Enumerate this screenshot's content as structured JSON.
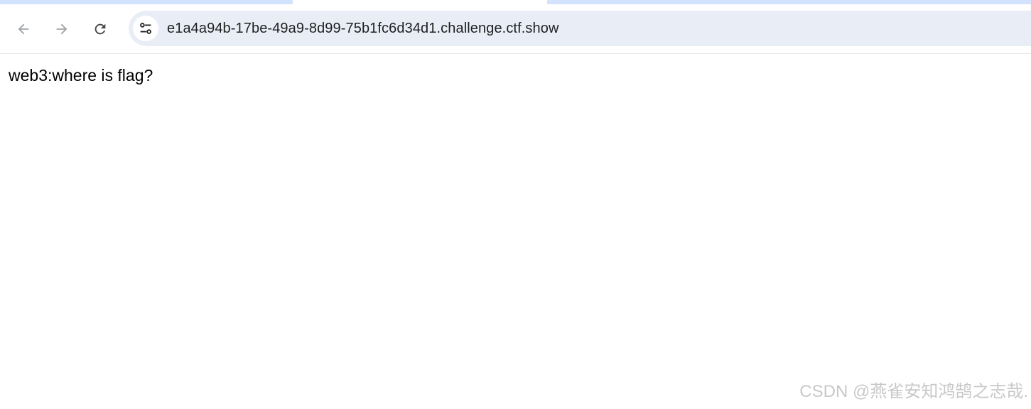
{
  "browser": {
    "nav": {
      "back_icon": "arrow-left-icon",
      "forward_icon": "arrow-right-icon",
      "reload_icon": "reload-icon",
      "icon_color": "#a0a4a8",
      "reload_color": "#474747"
    },
    "omnibox": {
      "site_info_icon": "tune-icon",
      "url": "e1a4a94b-17be-49a9-8d99-75b1fc6d34d1.challenge.ctf.show",
      "background": "#e9eef6"
    },
    "tabstrip_color": "#d3e3fd"
  },
  "page": {
    "text": "web3:where is flag?"
  },
  "watermark": {
    "text": "CSDN @燕雀安知鸿鹄之志哉."
  }
}
